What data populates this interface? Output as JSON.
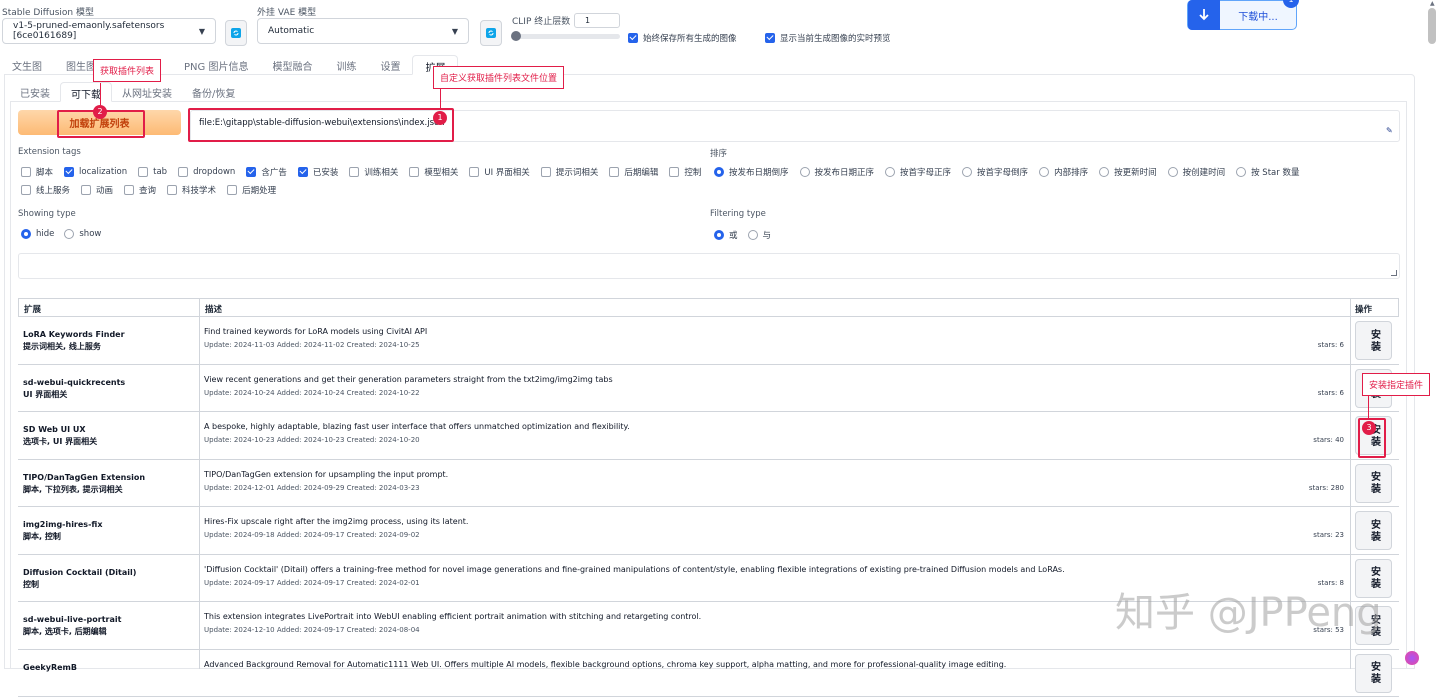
{
  "header": {
    "model_label": "Stable Diffusion 模型",
    "model_value": "v1-5-pruned-emaonly.safetensors [6ce0161689]",
    "vae_label": "外挂 VAE 模型",
    "vae_value": "Automatic",
    "clip_label": "CLIP 终止层数",
    "clip_value": "1",
    "clip_level": 0.0,
    "always_save_label": "始终保存所有生成的图像",
    "show_preview_label": "显示当前生成图像的实时预览",
    "download_label": "下载中..."
  },
  "tabs": [
    "文生图",
    "图生图",
    "后期处理",
    "PNG 图片信息",
    "模型融合",
    "训练",
    "设置",
    "扩展"
  ],
  "active_tab": "扩展",
  "subtabs": [
    "已安装",
    "可下载",
    "从网址安装",
    "备份/恢复"
  ],
  "active_subtab": "可下载",
  "load_button": "加载扩展列表",
  "url_value": "file:E:\\gitapp\\stable-diffusion-webui\\extensions\\index.json",
  "extension_tags_label": "Extension tags",
  "tags_row1": [
    {
      "label": "脚本",
      "checked": false
    },
    {
      "label": "localization",
      "checked": true
    },
    {
      "label": "tab",
      "checked": false
    },
    {
      "label": "dropdown",
      "checked": false
    },
    {
      "label": "含广告",
      "checked": true
    },
    {
      "label": "已安装",
      "checked": true
    },
    {
      "label": "训练相关",
      "checked": false
    },
    {
      "label": "模型相关",
      "checked": false
    },
    {
      "label": "UI 界面相关",
      "checked": false
    },
    {
      "label": "提示词相关",
      "checked": false
    },
    {
      "label": "后期编辑",
      "checked": false
    },
    {
      "label": "控制",
      "checked": false
    }
  ],
  "tags_row2": [
    {
      "label": "线上服务",
      "checked": false
    },
    {
      "label": "动画",
      "checked": false
    },
    {
      "label": "查询",
      "checked": false
    },
    {
      "label": "科技学术",
      "checked": false
    },
    {
      "label": "后期处理",
      "checked": false
    }
  ],
  "sort_label": "排序",
  "sort_options": [
    {
      "label": "按发布日期倒序",
      "checked": true
    },
    {
      "label": "按发布日期正序",
      "checked": false
    },
    {
      "label": "按首字母正序",
      "checked": false
    },
    {
      "label": "按首字母倒序",
      "checked": false
    },
    {
      "label": "内部排序",
      "checked": false
    },
    {
      "label": "按更新时间",
      "checked": false
    },
    {
      "label": "按创建时间",
      "checked": false
    },
    {
      "label": "按 Star 数量",
      "checked": false
    }
  ],
  "showing_type_label": "Showing type",
  "showing_options": [
    {
      "label": "hide",
      "checked": true
    },
    {
      "label": "show",
      "checked": false
    }
  ],
  "filtering_type_label": "Filtering type",
  "filtering_options": [
    {
      "label": "或",
      "checked": true
    },
    {
      "label": "与",
      "checked": false
    }
  ],
  "table": {
    "headers": [
      "扩展",
      "描述",
      "操作"
    ],
    "install_label": "安装",
    "rows": [
      {
        "name": "LoRA Keywords Finder",
        "tags": "提示词相关, 线上服务",
        "desc": "Find trained keywords for LoRA models using CivitAI API",
        "dates": "Update: 2024-11-03 Added: 2024-11-02 Created: 2024-10-25",
        "stars": "stars: 6"
      },
      {
        "name": "sd-webui-quickrecents",
        "tags": "UI 界面相关",
        "desc": "View recent generations and get their generation parameters straight from the txt2img/img2img tabs",
        "dates": "Update: 2024-10-24 Added: 2024-10-24 Created: 2024-10-22",
        "stars": "stars: 6"
      },
      {
        "name": "SD Web UI UX",
        "tags": "选项卡, UI 界面相关",
        "desc": "A bespoke, highly adaptable, blazing fast user interface that offers unmatched optimization and flexibility.",
        "dates": "Update: 2024-10-23 Added: 2024-10-23 Created: 2024-10-20",
        "stars": "stars: 40"
      },
      {
        "name": "TIPO/DanTagGen Extension",
        "tags": "脚本, 下拉列表, 提示词相关",
        "desc": "TIPO/DanTagGen extension for upsampling the input prompt.",
        "dates": "Update: 2024-12-01 Added: 2024-09-29 Created: 2024-03-23",
        "stars": "stars: 280"
      },
      {
        "name": "img2img-hires-fix",
        "tags": "脚本, 控制",
        "desc": "Hires-Fix upscale right after the img2img process, using its latent.",
        "dates": "Update: 2024-09-18 Added: 2024-09-17 Created: 2024-09-02",
        "stars": "stars: 23"
      },
      {
        "name": "Diffusion Cocktail (Ditail)",
        "tags": "控制",
        "desc": "'Diffusion Cocktail' (Ditail) offers a training-free method for novel image generations and fine-grained manipulations of content/style, enabling flexible integrations of existing pre-trained Diffusion models and LoRAs.",
        "dates": "Update: 2024-09-17 Added: 2024-09-17 Created: 2024-02-01",
        "stars": "stars: 8"
      },
      {
        "name": "sd-webui-live-portrait",
        "tags": "脚本, 选项卡, 后期编辑",
        "desc": "This extension integrates LivePortrait into WebUI enabling efficient portrait animation with stitching and retargeting control.",
        "dates": "Update: 2024-12-10 Added: 2024-09-17 Created: 2024-08-04",
        "stars": "stars: 53"
      },
      {
        "name": "GeekyRemB",
        "tags": "",
        "desc": "Advanced Background Removal for Automatic1111 Web UI. Offers multiple AI models, flexible background options, chroma key support, alpha matting, and more for professional-quality image editing.",
        "dates": "",
        "stars": ""
      }
    ]
  },
  "annotations": {
    "note1": "自定义获取插件列表文件位置",
    "note2": "获取插件列表",
    "note3": "安装指定插件",
    "n1": "1",
    "n2": "2",
    "n3": "3"
  },
  "watermark": "知乎 @JPPeng",
  "download_badge": "1"
}
